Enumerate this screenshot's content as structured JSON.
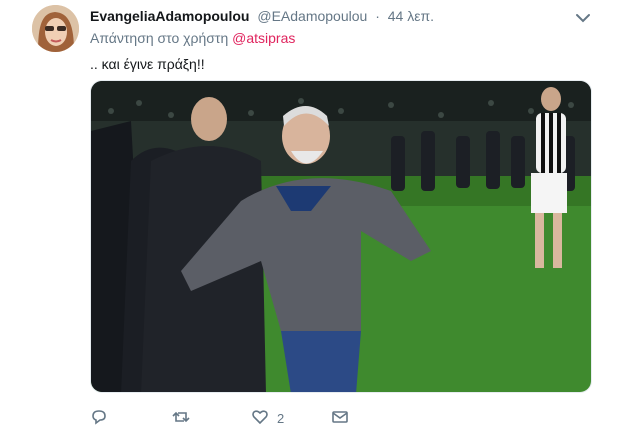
{
  "tweet": {
    "author_name": "EvangeliaAdamopoulou",
    "author_handle": "@EAdamopoulou",
    "separator": "·",
    "time": "44 λεπ.",
    "reply_prefix": "Απάντηση στο χρήστη",
    "reply_mention": "@atsipras",
    "text": ".. και έγινε πράξη!!",
    "media_icon": "photo",
    "actions": {
      "reply": {
        "icon": "reply-icon",
        "count": ""
      },
      "retweet": {
        "icon": "retweet-icon",
        "count": ""
      },
      "like": {
        "icon": "heart-icon",
        "count": "2"
      },
      "dm": {
        "icon": "envelope-icon",
        "count": ""
      }
    }
  },
  "colors": {
    "mention": "#e0245e",
    "secondary_text": "#657786",
    "primary_text": "#14171a"
  }
}
